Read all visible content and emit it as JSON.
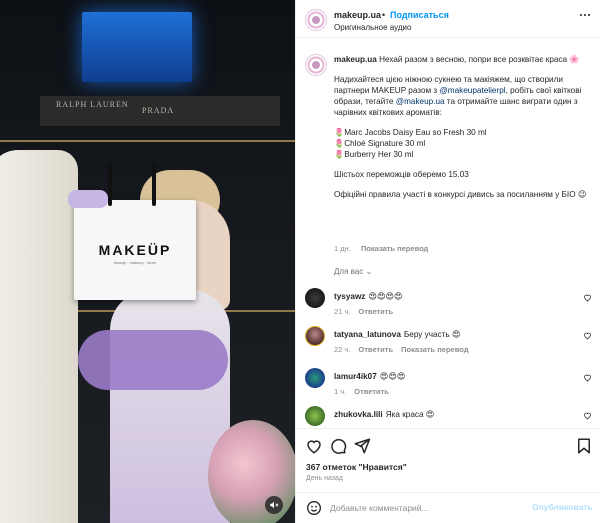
{
  "header": {
    "username": "makeup.ua",
    "dot": "•",
    "follow_label": "Подписаться",
    "audio_label": "Оригинальное аудио",
    "more_icon": "more-horizontal-icon"
  },
  "caption": {
    "username": "makeup.ua",
    "line1": "Нехай разом з весною, попри все розквітає краса 🌸",
    "p2_a": "Надихайтеся цією ніжною сукнею та макіяжем, що створили партнери MAKEUP разом з ",
    "p2_link1": "@makeupatelierpl",
    "p2_b": ", робіть свої квіткові образи, тегайте ",
    "p2_link2": "@makeup.ua",
    "p2_c": " та отримайте шанс виграти один з чарівних квіткових ароматів:",
    "prize1": "🌷Marc Jacobs Daisy Eau so Fresh 30 ml",
    "prize2": "🌷Chloé Signature 30 ml",
    "prize3": "🌷Burberry Her 30 ml",
    "winners": "Шістьох переможців оберемо 15.03",
    "rules": "Офіційні правила участі в конкурсі дивись за посиланням у БІО 😉",
    "time": "1 дн.",
    "translate_label": "Показать перевод"
  },
  "for_you_label": "Для вас ⌄",
  "comments": [
    {
      "username": "tysyawz",
      "text": "😍😍😍😍",
      "time": "21 ч.",
      "reply": "Ответить",
      "translate": ""
    },
    {
      "username": "tatyana_latunova",
      "text": "Беру участь 😍",
      "time": "22 ч.",
      "reply": "Ответить",
      "translate": "Показать перевод"
    },
    {
      "username": "lamur4ik07",
      "text": "😍😍😍",
      "time": "1 ч.",
      "reply": "Ответить",
      "translate": ""
    },
    {
      "username": "zhukovka.lili",
      "text": "Яка краса 😍",
      "time": "",
      "reply": "",
      "translate": ""
    }
  ],
  "media": {
    "brand1": "RALPH LAUREN",
    "brand2": "PRADA",
    "bag_logo": "MAKEÜP",
    "bag_sub": "beauty · makeup · store"
  },
  "actions": {
    "like_icon": "heart-icon",
    "comment_icon": "comment-icon",
    "share_icon": "send-icon",
    "save_icon": "bookmark-icon"
  },
  "likes_label": "367 отметок \"Нравится\"",
  "date_label": "День назад",
  "add_comment": {
    "placeholder": "Добавьте комментарий...",
    "post_label": "Опубликовать"
  },
  "colors": {
    "accent": "#0095f6",
    "link": "#00376b",
    "muted": "#8e8e8e"
  }
}
